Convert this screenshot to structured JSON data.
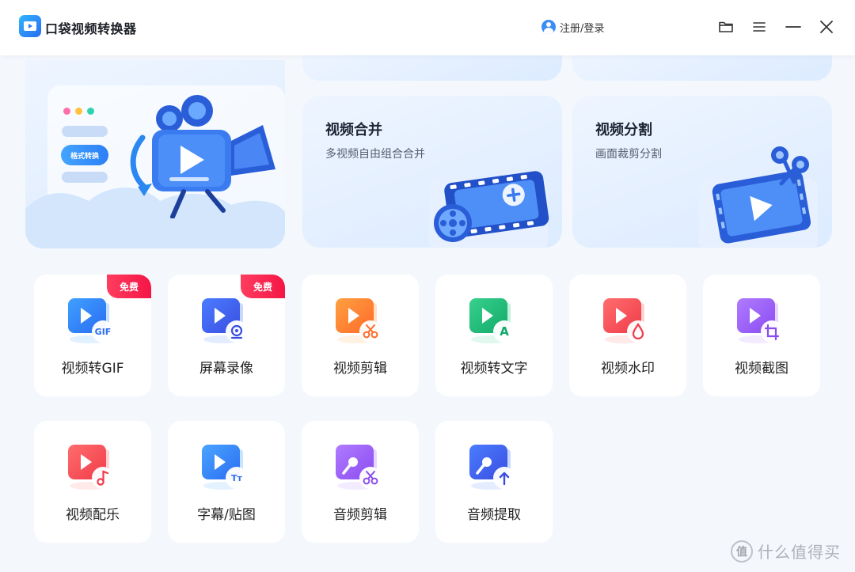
{
  "app": {
    "title": "口袋视频转换器"
  },
  "header": {
    "login_label": "注册/登录",
    "controls": [
      "folder-icon",
      "menu-icon",
      "minimize-icon",
      "close-icon"
    ]
  },
  "banners": {
    "convert": {
      "pill_label": "格式转换"
    },
    "merge": {
      "title": "视频合并",
      "subtitle": "多视频自由组合合并"
    },
    "split": {
      "title": "视频分割",
      "subtitle": "画面裁剪分割"
    }
  },
  "badge_label": "免费",
  "tools": [
    {
      "label": "视频转GIF",
      "icon": "gif-icon",
      "free": true,
      "colors": [
        "#3fa0ff",
        "#2a6cf2"
      ],
      "sub_glyph": "GIF"
    },
    {
      "label": "屏幕录像",
      "icon": "webcam-icon",
      "free": true,
      "colors": [
        "#4a7dff",
        "#3a4de0"
      ],
      "sub_glyph": ""
    },
    {
      "label": "视频剪辑",
      "icon": "scissors-icon",
      "free": false,
      "colors": [
        "#ffa040",
        "#ff6a2a"
      ],
      "sub_glyph": ""
    },
    {
      "label": "视频转文字",
      "icon": "text-a-icon",
      "free": false,
      "colors": [
        "#37d08c",
        "#14aa6a"
      ],
      "sub_glyph": "A"
    },
    {
      "label": "视频水印",
      "icon": "droplet-icon",
      "free": false,
      "colors": [
        "#ff6d6d",
        "#f03b4a"
      ],
      "sub_glyph": ""
    },
    {
      "label": "视频截图",
      "icon": "crop-icon",
      "free": false,
      "colors": [
        "#b07bff",
        "#8a4cf0"
      ],
      "sub_glyph": ""
    },
    {
      "label": "视频配乐",
      "icon": "music-note-icon",
      "free": false,
      "colors": [
        "#ff6d6d",
        "#f03b4a"
      ],
      "sub_glyph": ""
    },
    {
      "label": "字幕/贴图",
      "icon": "subtitle-tt-icon",
      "free": false,
      "colors": [
        "#4aa5ff",
        "#2a6cf2"
      ],
      "sub_glyph": "Tт"
    },
    {
      "label": "音频剪辑",
      "icon": "mic-scissors-icon",
      "free": false,
      "colors": [
        "#b07bff",
        "#8a4cf0"
      ],
      "sub_glyph": ""
    },
    {
      "label": "音频提取",
      "icon": "mic-upload-icon",
      "free": false,
      "colors": [
        "#4a7dff",
        "#3a4de0"
      ],
      "sub_glyph": ""
    }
  ],
  "watermark": {
    "text": "什么值得买",
    "glyph": "值"
  }
}
